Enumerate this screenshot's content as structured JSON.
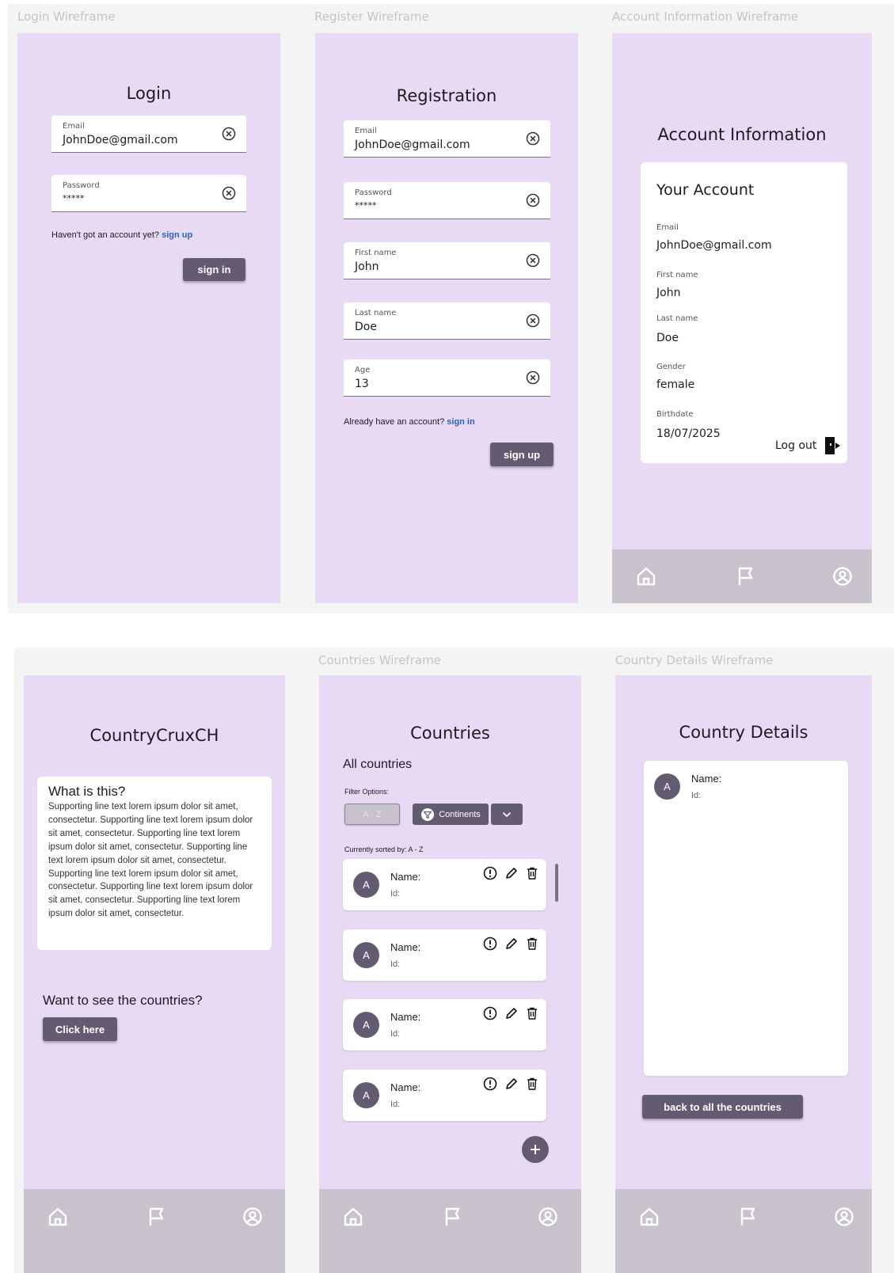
{
  "login": {
    "frame_label": "Login Wireframe",
    "title": "Login",
    "email_label": "Email",
    "email_value": "JohnDoe@gmail.com",
    "password_label": "Password",
    "password_value": "*****",
    "helper_text": "Haven't got an account yet?",
    "helper_link": "sign up",
    "button": "sign in"
  },
  "register": {
    "frame_label": "Register Wireframe",
    "title": "Registration",
    "fields": [
      {
        "label": "Email",
        "value": "JohnDoe@gmail.com"
      },
      {
        "label": "Password",
        "value": "*****"
      },
      {
        "label": "First name",
        "value": "John"
      },
      {
        "label": "Last name",
        "value": "Doe"
      },
      {
        "label": "Age",
        "value": "13"
      }
    ],
    "helper_text": "Already have an account?",
    "helper_link": "sign in",
    "button": "sign up"
  },
  "account": {
    "frame_label": "Account Information Wireframe",
    "title": "Account Information",
    "card_title": "Your Account",
    "rows": [
      {
        "label": "Email",
        "value": "JohnDoe@gmail.com"
      },
      {
        "label": "First name",
        "value": "John"
      },
      {
        "label": "Last name",
        "value": "Doe"
      },
      {
        "label": "Gender",
        "value": "female"
      },
      {
        "label": "Birthdate",
        "value": "18/07/2025"
      }
    ],
    "logout": "Log out"
  },
  "home": {
    "title": "CountryCruxCH",
    "card_title": "What is this?",
    "card_body": "Supporting line text lorem ipsum dolor sit amet, consectetur. Supporting line text lorem ipsum dolor sit amet, consectetur. Supporting line text lorem ipsum dolor sit amet, consectetur. Supporting line text lorem ipsum dolor sit amet, consectetur. Supporting line text lorem ipsum dolor sit amet, consectetur. Supporting line text lorem ipsum dolor sit amet, consectetur. Supporting line text lorem ipsum dolor sit amet, consectetur.",
    "cta_text": "Want to see the countries?",
    "button": "Click here"
  },
  "countries": {
    "frame_label": "Countries Wireframe",
    "title": "Countries",
    "subtitle": "All countries",
    "filter_label": "Filter Options:",
    "sort_button": "A - Z",
    "continents_button": "Continents",
    "sorted_by": "Currently sorted by: A - Z",
    "items": [
      {
        "avatar": "A",
        "name": "Name:",
        "id": "Id:"
      },
      {
        "avatar": "A",
        "name": "Name:",
        "id": "Id:"
      },
      {
        "avatar": "A",
        "name": "Name:",
        "id": "Id:"
      },
      {
        "avatar": "A",
        "name": "Name:",
        "id": "Id:"
      }
    ],
    "add_symbol": "+"
  },
  "details": {
    "frame_label": "Country Details Wireframe",
    "title": "Country Details",
    "avatar": "A",
    "name": "Name:",
    "id": "Id:",
    "button": "back to all the countries"
  },
  "colors": {
    "phone_bg": "#e8daf5",
    "primary": "#625b71",
    "navbar": "#c7c2cc",
    "link": "#2f5fb8"
  },
  "icons": {
    "clear": "circle-x-icon",
    "home": "home-icon",
    "flag": "flag-icon",
    "profile": "account-circle-icon",
    "logout": "logout-icon",
    "info": "info-icon",
    "edit": "pencil-icon",
    "delete": "trash-icon",
    "filter": "filter-icon",
    "dropdown": "chevron-down-icon",
    "add": "plus-icon"
  }
}
